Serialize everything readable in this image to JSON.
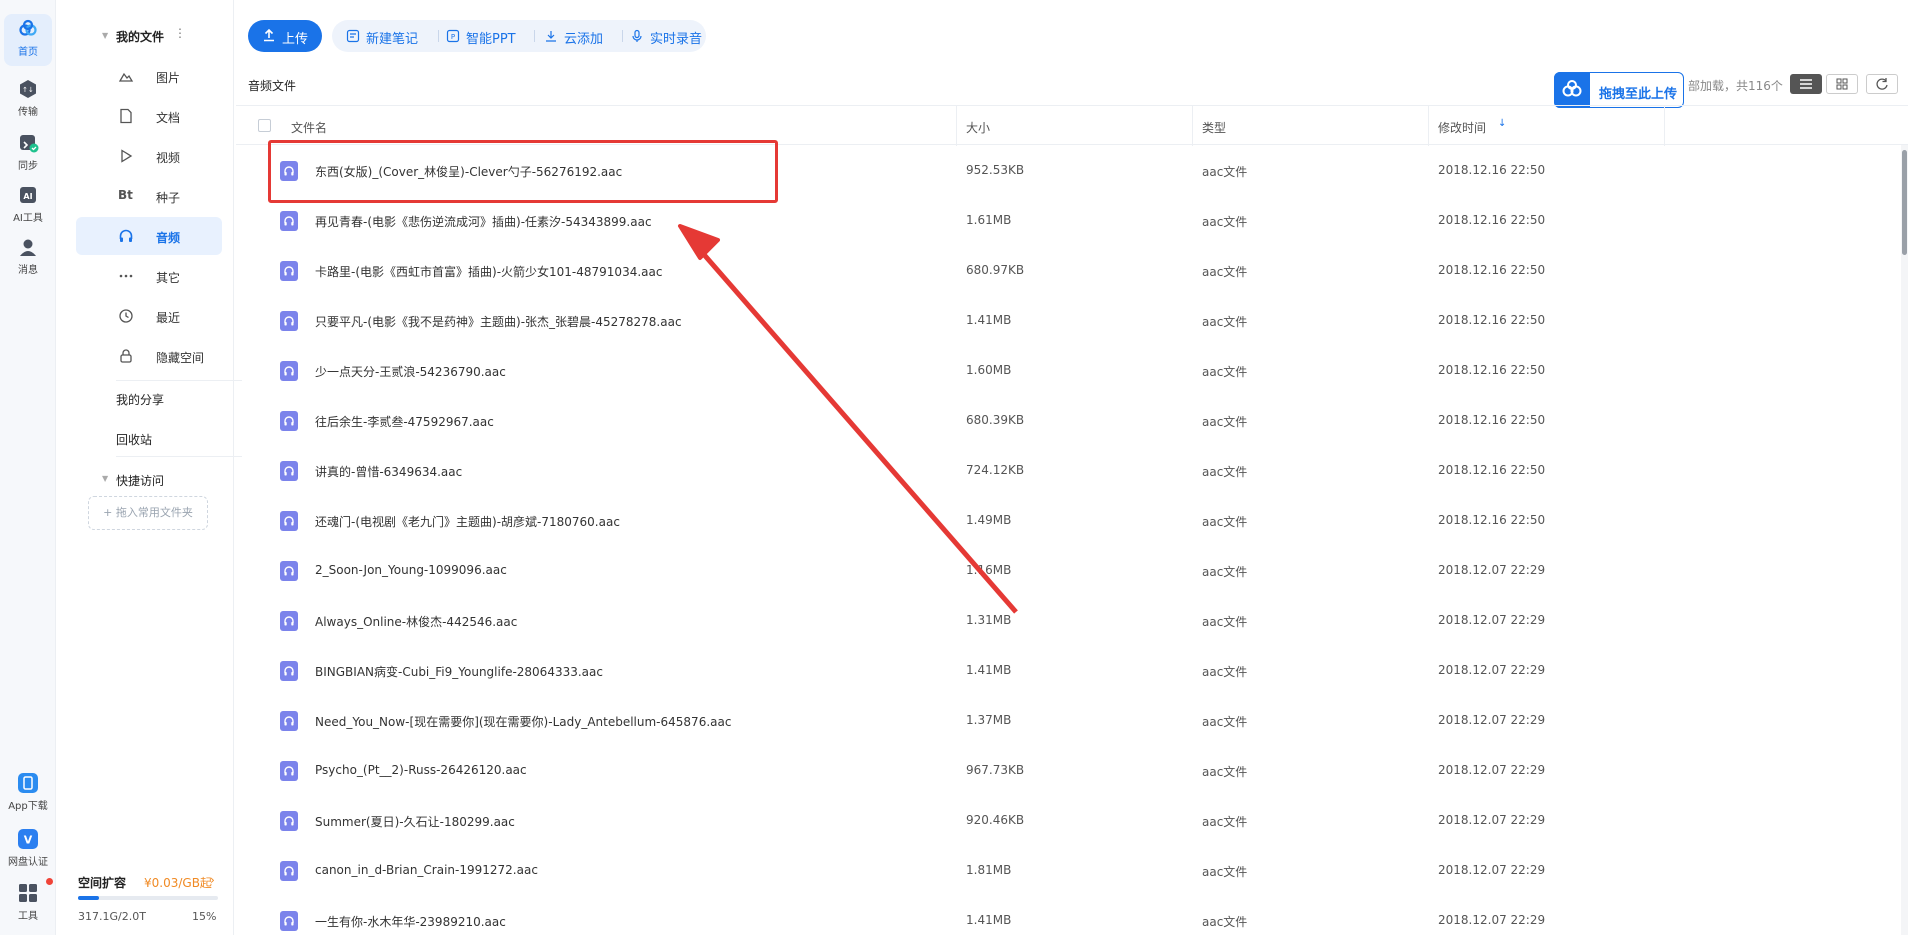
{
  "rail": [
    {
      "label": "首页",
      "icon": "baidu-cloud-icon",
      "active": true
    },
    {
      "label": "传输",
      "icon": "transfer-icon"
    },
    {
      "label": "同步",
      "icon": "sync-icon"
    },
    {
      "label": "AI工具",
      "icon": "ai-tool-icon"
    },
    {
      "label": "消息",
      "icon": "message-icon"
    },
    {
      "label": "App下载",
      "icon": "app-download-icon"
    },
    {
      "label": "网盘认证",
      "icon": "verify-icon"
    },
    {
      "label": "工具",
      "icon": "tools-icon"
    }
  ],
  "nav": {
    "header": "我的文件",
    "items": [
      {
        "label": "图片",
        "icon": "image-icon"
      },
      {
        "label": "文档",
        "icon": "document-icon"
      },
      {
        "label": "视频",
        "icon": "video-icon"
      },
      {
        "label": "种子",
        "icon": "torrent-icon",
        "glyph": "Bt"
      },
      {
        "label": "音频",
        "icon": "headphones-icon",
        "active": true
      },
      {
        "label": "其它",
        "icon": "more-icon"
      },
      {
        "label": "最近",
        "icon": "clock-icon"
      },
      {
        "label": "隐藏空间",
        "icon": "lock-icon"
      }
    ],
    "my_share": "我的分享",
    "recycle": "回收站",
    "quick_access": "快捷访问",
    "quick_add": "+ 拖入常用文件夹"
  },
  "storage": {
    "title": "空间扩容",
    "price": "¥0.03/GB起",
    "used": "317.1G/2.0T",
    "percent_label": "15%",
    "percent": 15
  },
  "toolbar": {
    "upload": "上传",
    "tools": [
      {
        "label": "新建笔记",
        "icon": "note-icon"
      },
      {
        "label": "智能PPT",
        "icon": "ppt-icon"
      },
      {
        "label": "云添加",
        "icon": "cloud-add-icon"
      },
      {
        "label": "实时录音",
        "icon": "mic-icon"
      }
    ]
  },
  "section": {
    "title": "音频文件",
    "drag_upload": "拖拽至此上传",
    "load_info": "部加载，共116个"
  },
  "table": {
    "headers": {
      "name": "文件名",
      "size": "大小",
      "type": "类型",
      "modified": "修改时间"
    },
    "rows": [
      {
        "name": "东西(女版)_(Cover_林俊呈)-Clever勺子-56276192.aac",
        "size": "952.53KB",
        "type": "aac文件",
        "modified": "2018.12.16 22:50"
      },
      {
        "name": "再见青春-(电影《悲伤逆流成河》插曲)-任素汐-54343899.aac",
        "size": "1.61MB",
        "type": "aac文件",
        "modified": "2018.12.16 22:50"
      },
      {
        "name": "卡路里-(电影《西虹市首富》插曲)-火箭少女101-48791034.aac",
        "size": "680.97KB",
        "type": "aac文件",
        "modified": "2018.12.16 22:50"
      },
      {
        "name": "只要平凡-(电影《我不是药神》主题曲)-张杰_张碧晨-45278278.aac",
        "size": "1.41MB",
        "type": "aac文件",
        "modified": "2018.12.16 22:50"
      },
      {
        "name": "少一点天分-王贰浪-54236790.aac",
        "size": "1.60MB",
        "type": "aac文件",
        "modified": "2018.12.16 22:50"
      },
      {
        "name": "往后余生-李贰叁-47592967.aac",
        "size": "680.39KB",
        "type": "aac文件",
        "modified": "2018.12.16 22:50"
      },
      {
        "name": "讲真的-曾惜-6349634.aac",
        "size": "724.12KB",
        "type": "aac文件",
        "modified": "2018.12.16 22:50"
      },
      {
        "name": "还魂门-(电视剧《老九门》主题曲)-胡彦斌-7180760.aac",
        "size": "1.49MB",
        "type": "aac文件",
        "modified": "2018.12.16 22:50"
      },
      {
        "name": "2_Soon-Jon_Young-1099096.aac",
        "size": "1.16MB",
        "type": "aac文件",
        "modified": "2018.12.07 22:29"
      },
      {
        "name": "Always_Online-林俊杰-442546.aac",
        "size": "1.31MB",
        "type": "aac文件",
        "modified": "2018.12.07 22:29"
      },
      {
        "name": "BINGBIAN病变-Cubi_Fi9_Younglife-28064333.aac",
        "size": "1.41MB",
        "type": "aac文件",
        "modified": "2018.12.07 22:29"
      },
      {
        "name": "Need_You_Now-[现在需要你](现在需要你)-Lady_Antebellum-645876.aac",
        "size": "1.37MB",
        "type": "aac文件",
        "modified": "2018.12.07 22:29"
      },
      {
        "name": "Psycho_(Pt__2)-Russ-26426120.aac",
        "size": "967.73KB",
        "type": "aac文件",
        "modified": "2018.12.07 22:29"
      },
      {
        "name": "Summer(夏日)-久石让-180299.aac",
        "size": "920.46KB",
        "type": "aac文件",
        "modified": "2018.12.07 22:29"
      },
      {
        "name": "canon_in_d-Brian_Crain-1991272.aac",
        "size": "1.81MB",
        "type": "aac文件",
        "modified": "2018.12.07 22:29"
      },
      {
        "name": "一生有你-水木年华-23989210.aac",
        "size": "1.41MB",
        "type": "aac文件",
        "modified": "2018.12.07 22:29"
      }
    ]
  },
  "colors": {
    "accent": "#1a73e8",
    "highlight": "#e53935",
    "audio_icon": "#7b83eb"
  }
}
